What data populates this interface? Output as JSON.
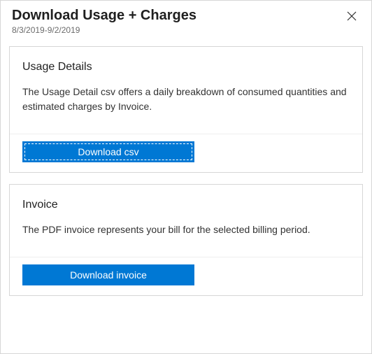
{
  "header": {
    "title": "Download Usage + Charges",
    "date_range": "8/3/2019-9/2/2019"
  },
  "cards": {
    "usage": {
      "title": "Usage Details",
      "description": "The Usage Detail csv offers a daily breakdown of consumed quantities and estimated charges by Invoice.",
      "button_label": "Download csv"
    },
    "invoice": {
      "title": "Invoice",
      "description": "The PDF invoice represents your bill for the selected billing period.",
      "button_label": "Download invoice"
    }
  }
}
